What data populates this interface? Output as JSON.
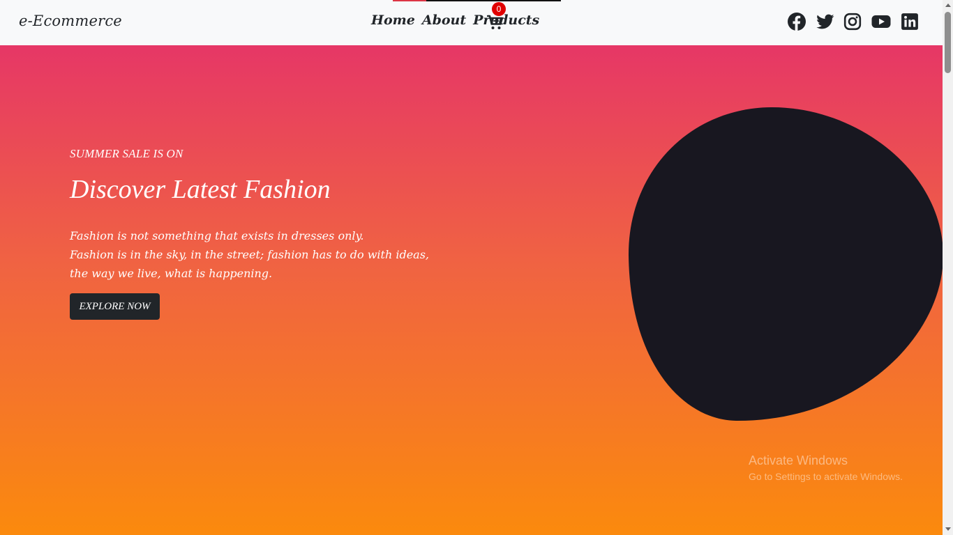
{
  "header": {
    "brand": "e-Ecommerce",
    "nav": [
      {
        "label": "Home"
      },
      {
        "label": "About"
      },
      {
        "label": "Products"
      }
    ],
    "cart_count": "0",
    "loading_progress": 0.2,
    "social": [
      {
        "icon": "facebook-icon"
      },
      {
        "icon": "twitter-icon"
      },
      {
        "icon": "instagram-icon"
      },
      {
        "icon": "youtube-icon"
      },
      {
        "icon": "linkedin-icon"
      }
    ]
  },
  "hero": {
    "eyebrow": "SUMMER SALE IS ON",
    "headline": "Discover Latest Fashion",
    "copy": [
      "Fashion is not something that exists in dresses only.",
      "Fashion is in the sky, in the street; fashion has to do with ideas,",
      "the way we live, what is happening."
    ],
    "cta": "EXPLORE NOW"
  },
  "watermark": {
    "title": "Activate Windows",
    "subtitle": "Go to Settings to activate Windows."
  },
  "colors": {
    "gradient_top": "#e63766",
    "gradient_bottom": "#fb8a0d",
    "blob": "#181720",
    "cart_badge": "#e00000",
    "button_bg": "#212529"
  }
}
